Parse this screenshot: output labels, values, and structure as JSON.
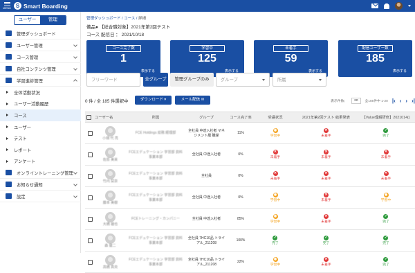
{
  "topbar": {
    "menu_label": "MENU",
    "app_name": "Smart Boarding"
  },
  "role_switch": {
    "user": "ユーザー",
    "admin": "管理"
  },
  "sidebar": {
    "items": [
      {
        "label": "管理ダッシュボード",
        "icon": "home-icon",
        "expandable": false
      },
      {
        "label": "ユーザー管理",
        "icon": "users-icon",
        "expandable": true
      },
      {
        "label": "コース管理",
        "icon": "folder-icon",
        "expandable": true
      },
      {
        "label": "自社コンテンツ管理",
        "icon": "folder-icon",
        "expandable": true
      },
      {
        "label": "学習進捗管理",
        "icon": "chart-icon",
        "expandable": true,
        "expanded": true
      }
    ],
    "sub_items": [
      "全体活動状況",
      "ユーザー活動履歴",
      "コース",
      "ユーザー",
      "テスト",
      "レポート",
      "アンケート"
    ],
    "active_sub": 2,
    "bottom_items": [
      {
        "label": "オンライントレーニング管理",
        "icon": "video-icon"
      },
      {
        "label": "お知らせ通知",
        "icon": "mail-icon"
      },
      {
        "label": "設定",
        "icon": "gear-icon"
      }
    ]
  },
  "breadcrumb": {
    "root": "管理ダッシュボード",
    "sep1": "/",
    "mid": "コース",
    "sep2": "/",
    "current": "詳細"
  },
  "course": {
    "title": "備品● 【総合職対象】2021年第2回テスト",
    "date_label": "コース 配信日 ：",
    "date": "2021/10/18"
  },
  "cards": [
    {
      "header": "コース完了数",
      "value": "1",
      "link": "表示する"
    },
    {
      "header": "学習中",
      "value": "125",
      "link": "表示する"
    },
    {
      "header": "未着手",
      "value": "59",
      "link": "表示する"
    },
    {
      "header": "配信ユーザー数",
      "value": "185",
      "link": "表示する"
    }
  ],
  "filters": {
    "free_word_placeholder": "フリーワード",
    "all_groups": "全グループ",
    "admin_groups_only": "管理グループのみ",
    "group_placeholder": "グループ",
    "affiliation_placeholder": "所属"
  },
  "toolbar": {
    "selection_count": "0 件 / 全 185 件選択中",
    "download_label": "ダウンロード",
    "mail_label": "メール配信",
    "per_page_label": "表示件数：",
    "per_page_value": "20",
    "range_label": "全185件中 1-20"
  },
  "table": {
    "headers": [
      "ユーザー名",
      "所属",
      "グループ",
      "コース完了率",
      "受講状況",
      "2021年第2回テスト 結果発表",
      "【Value理解研修】2021014()"
    ],
    "rows": [
      {
        "name": "小畑 代 亮",
        "affiliation": "FCE Holdings 総務 経理部",
        "group": "全社員 中途入社者 マネジメント層 職掌",
        "rate": "11%",
        "s1": [
          "pr",
          "学習中"
        ],
        "s2": [
          "ng",
          "未着手"
        ],
        "s3": [
          "ok",
          "完了"
        ]
      },
      {
        "name": "佐原 美来",
        "affiliation": "FCEエデュケーション 学習部 資料事業本部",
        "group": "全社員 中途入社者",
        "rate": "0%",
        "s1": [
          "ng",
          "未着手"
        ],
        "s2": [
          "ng",
          "未着手"
        ],
        "s3": [
          "ng",
          "未着手"
        ]
      },
      {
        "name": "竹内 栞奈",
        "affiliation": "FCEエデュケーション 学習部 資料事業本部",
        "group": "全社員",
        "rate": "0%",
        "s1": [
          "ng",
          "未着手"
        ],
        "s2": [
          "ng",
          "未着手"
        ],
        "s3": [
          "ng",
          "未着手"
        ]
      },
      {
        "name": "藤本 美樹",
        "affiliation": "FCEエデュケーション 学習部 資料事業本部",
        "group": "全社員 中途入社者",
        "rate": "0%",
        "s1": [
          "pr",
          "学習中"
        ],
        "s2": [
          "ng",
          "未着手"
        ],
        "s3": [
          "pr",
          "学習中"
        ]
      },
      {
        "name": "大橋 雄也",
        "affiliation": "FCEトレーニング・カンパニー",
        "group": "全社員 中途入社者",
        "rate": "85%",
        "s1": [
          "pr",
          "学習中"
        ],
        "s2": [
          "ng",
          "未着手"
        ],
        "s3": [
          "ok",
          "完了"
        ]
      },
      {
        "name": "森 健二",
        "affiliation": "FCEエデュケーション 学習部 資料事業本部",
        "group": "全社員 7HC10品 トライアル_211208",
        "rate": "100%",
        "s1": [
          "ok",
          "完了"
        ],
        "s2": [
          "ok",
          "完了"
        ],
        "s3": [
          "ok",
          "完了"
        ]
      },
      {
        "name": "高橋 真央",
        "affiliation": "FCEエデュケーション 学習部 資料事業本部",
        "group": "全社員 7HC10品 トライアル_211208",
        "rate": "22%",
        "s1": [
          "pr",
          "学習中"
        ],
        "s2": [
          "ng",
          "未着手"
        ],
        "s3": [
          "ok",
          "完了"
        ]
      }
    ]
  },
  "colors": {
    "brand": "#1a4fa3",
    "done": "#2f9b3e",
    "not_started": "#e13a3a",
    "in_progress": "#f4a21d"
  }
}
